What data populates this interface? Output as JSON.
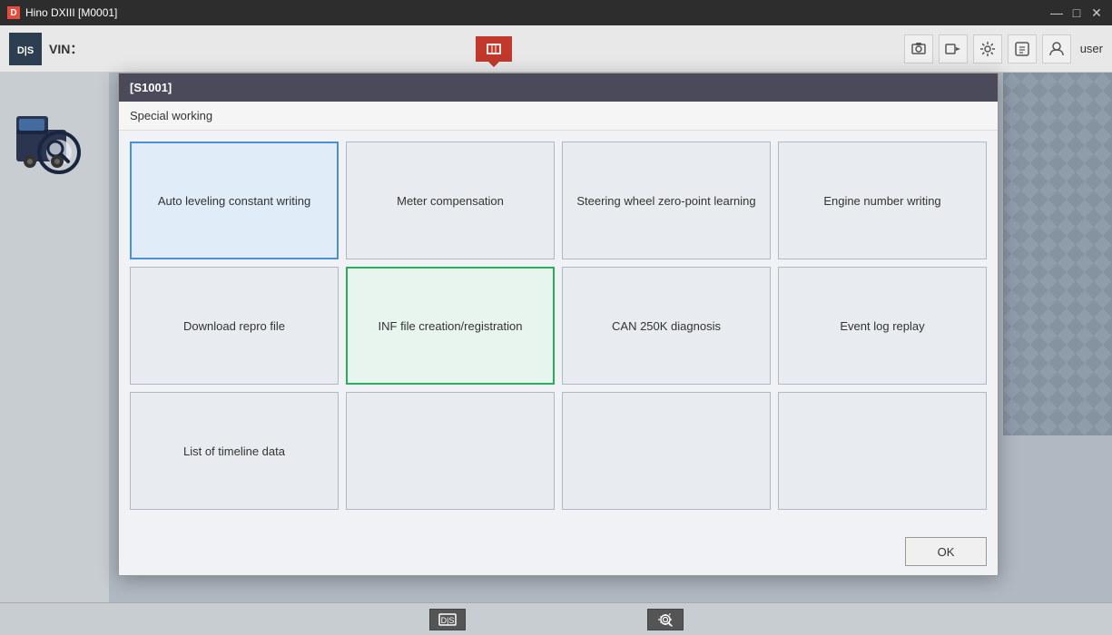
{
  "titlebar": {
    "title": "Hino DXIII [M0001]",
    "icon_label": "D",
    "min_btn": "—",
    "max_btn": "□",
    "close_btn": "✕"
  },
  "toolbar": {
    "logo_text": "D|S",
    "vin_label": "VIN：",
    "user_label": "user"
  },
  "modal": {
    "header": "[S1001]",
    "subheader": "Special working",
    "grid_row1": [
      {
        "id": "auto-leveling",
        "label": "Auto leveling constant writing",
        "state": "selected-blue"
      },
      {
        "id": "meter-compensation",
        "label": "Meter compensation",
        "state": "normal"
      },
      {
        "id": "steering-wheel",
        "label": "Steering wheel zero-point learning",
        "state": "normal"
      },
      {
        "id": "engine-number",
        "label": "Engine number writing",
        "state": "normal"
      }
    ],
    "grid_row2": [
      {
        "id": "download-repro",
        "label": "Download repro file",
        "state": "normal"
      },
      {
        "id": "inf-file",
        "label": "INF file creation/registration",
        "state": "selected-green"
      },
      {
        "id": "can-250k",
        "label": "CAN 250K diagnosis",
        "state": "normal"
      },
      {
        "id": "event-log",
        "label": "Event log replay",
        "state": "normal"
      }
    ],
    "grid_row3": [
      {
        "id": "list-timeline",
        "label": "List of timeline data",
        "state": "normal"
      },
      {
        "id": "empty1",
        "label": "",
        "state": "empty"
      },
      {
        "id": "empty2",
        "label": "",
        "state": "empty"
      },
      {
        "id": "empty3",
        "label": "",
        "state": "empty"
      }
    ],
    "ok_button": "OK"
  },
  "statusbar": {
    "left_icon": "≡",
    "right_icon": "⚙"
  }
}
